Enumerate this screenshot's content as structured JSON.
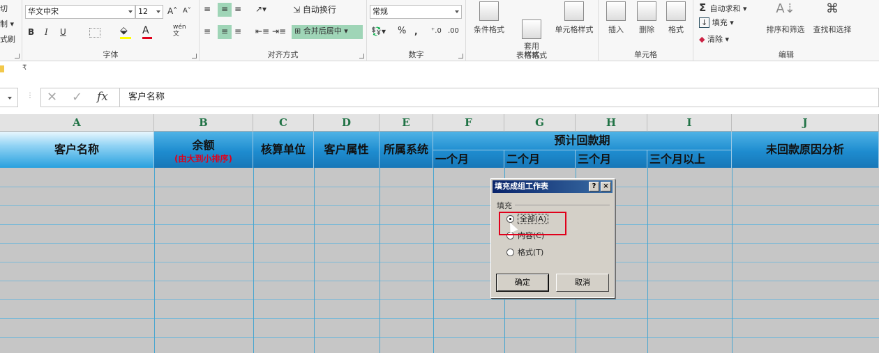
{
  "ribbon": {
    "clipboard": {
      "items": [
        "切",
        "制 ▾",
        "式刷"
      ]
    },
    "font": {
      "label": "字体",
      "font_name": "华文中宋",
      "font_size": "12",
      "grow": "A˄",
      "shrink": "A˅",
      "bold": "B",
      "italic": "I",
      "underline": "U",
      "wen": "wén\n文"
    },
    "align": {
      "label": "对齐方式",
      "wrap": "自动换行",
      "merge": "合并后居中"
    },
    "number": {
      "label": "数字",
      "format": "常规",
      "percent": "%",
      "comma": ",",
      "inc": "⁺.0",
      "dec": ".00"
    },
    "styles": {
      "label": "样式",
      "conditional": "条件格式",
      "table": "套用\n表格格式",
      "cell": "单元格样式"
    },
    "cells": {
      "label": "单元格",
      "insert": "插入",
      "delete": "删除",
      "format": "格式"
    },
    "editing": {
      "label": "编辑",
      "autosum": "自动求和",
      "fill": "填充",
      "clear": "清除",
      "sort": "排序和筛选",
      "find": "查找和选择"
    }
  },
  "formula": {
    "cancel": "✕",
    "enter": "✓",
    "fx": "fx",
    "value": "客户名称"
  },
  "columns": [
    "A",
    "B",
    "C",
    "D",
    "E",
    "F",
    "G",
    "H",
    "I",
    "J"
  ],
  "headers": {
    "a": "客户名称",
    "b": "余额",
    "b_sub": "(由大到小排序)",
    "c": "核算单位",
    "d": "客户属性",
    "e": "所属系统",
    "forecast": "预计回款期",
    "f": "一个月",
    "g": "二个月",
    "h": "三个月",
    "i": "三个月以上",
    "j": "未回款原因分析"
  },
  "dialog": {
    "title": "填充成组工作表",
    "help": "?",
    "close": "×",
    "group": "填充",
    "opt_all": "全部(A)",
    "opt_content": "内容(C)",
    "opt_format": "格式(T)",
    "ok": "确定",
    "cancel": "取消"
  },
  "colors": {
    "accent_red": "#e0001b",
    "header_blue": "#1e8ccf",
    "excel_green": "#217346"
  }
}
